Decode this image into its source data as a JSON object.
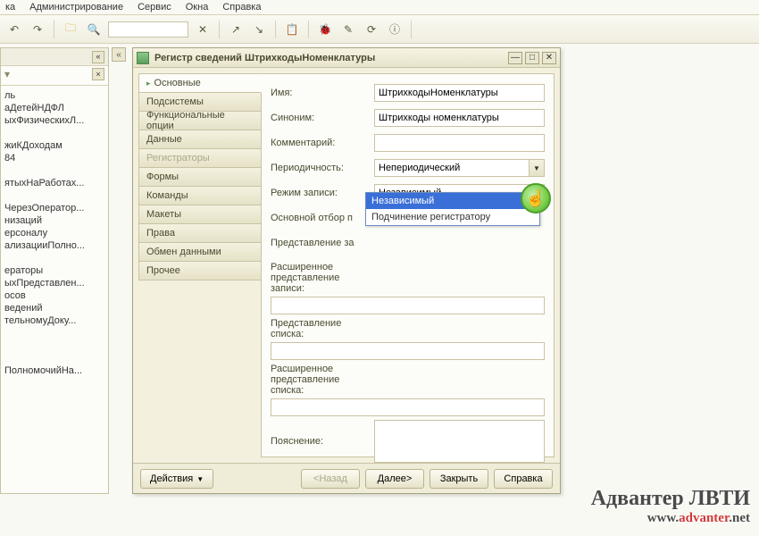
{
  "menu": {
    "items": [
      "ка",
      "Администрирование",
      "Сервис",
      "Окна",
      "Справка"
    ]
  },
  "tree": {
    "items": [
      "ль",
      "аДетейНДФЛ",
      "ыхФизическихЛ...",
      "",
      "жиКДоходам",
      "84",
      "",
      "ятыхНаРаботах...",
      "",
      "ЧерезОператор...",
      "низаций",
      "ерсоналу",
      "ализацииПолно...",
      "",
      "ераторы",
      "ыхПредставлен...",
      "осов",
      "ведений",
      "тельномуДоку...",
      "",
      "",
      "",
      "ПолномочийНа..."
    ]
  },
  "dialog": {
    "title": "Регистр сведений ШтрихкодыНоменклатуры",
    "tabs": [
      {
        "label": "Основные",
        "state": "active"
      },
      {
        "label": "Подсистемы",
        "state": ""
      },
      {
        "label": "Функциональные опции",
        "state": ""
      },
      {
        "label": "Данные",
        "state": ""
      },
      {
        "label": "Регистраторы",
        "state": "disabled"
      },
      {
        "label": "Формы",
        "state": ""
      },
      {
        "label": "Команды",
        "state": ""
      },
      {
        "label": "Макеты",
        "state": ""
      },
      {
        "label": "Права",
        "state": ""
      },
      {
        "label": "Обмен данными",
        "state": ""
      },
      {
        "label": "Прочее",
        "state": ""
      }
    ],
    "labels": {
      "name": "Имя:",
      "synonym": "Синоним:",
      "comment": "Комментарий:",
      "periodicity": "Периодичность:",
      "writemode": "Режим записи:",
      "mainselect": "Основной отбор п",
      "recview": "Представление за",
      "recviewext": "Расширенное представление записи:",
      "listview": "Представление списка:",
      "listviewext": "Расширенное представление списка:",
      "tooltip": "Пояснение:"
    },
    "fields": {
      "name": "ШтрихкодыНоменклатуры",
      "synonym": "Штрихкоды номенклатуры",
      "comment": "",
      "periodicity": "Непериодический",
      "writemode": "Независимый",
      "recview": "",
      "recviewext": "",
      "listview": "",
      "listviewext": "",
      "tooltip": ""
    },
    "dropdown": {
      "options": [
        "Независимый",
        "Подчинение регистратору"
      ],
      "selected": 0
    },
    "footer": {
      "actions": "Действия",
      "back": "<Назад",
      "next": "Далее>",
      "close": "Закрыть",
      "help": "Справка"
    }
  },
  "watermark": {
    "line1": "Адвантер ЛВТИ",
    "line2_pre": "www.",
    "line2_mid": "advanter",
    "line2_post": ".net"
  }
}
